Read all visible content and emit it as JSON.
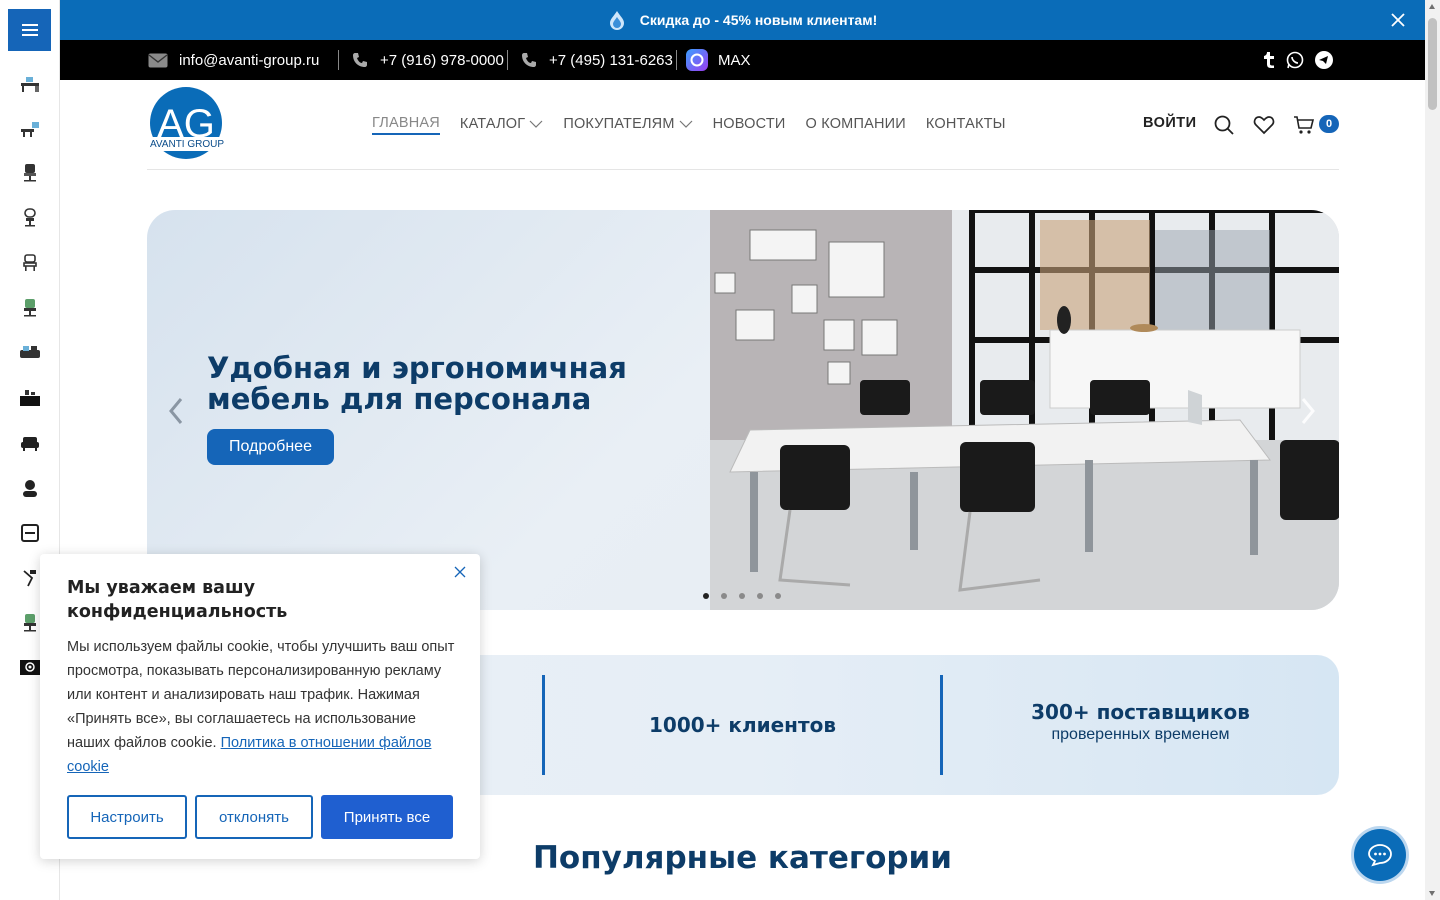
{
  "promo": {
    "text": "Скидка до - 45% новым клиентам!"
  },
  "contacts": {
    "email": "info@avanti-group.ru",
    "phone1": "+7 (916) 978-0000",
    "phone2": "+7 (495) 131-6263",
    "messenger": "MAX"
  },
  "header": {
    "logo_text": "AVANTI GROUP",
    "logo_mark": "AG",
    "nav": [
      {
        "label": "ГЛАВНАЯ"
      },
      {
        "label": "КАТАЛОГ"
      },
      {
        "label": "ПОКУПАТЕЛЯМ"
      },
      {
        "label": "НОВОСТИ"
      },
      {
        "label": "О КОМПАНИИ"
      },
      {
        "label": "КОНТАКТЫ"
      }
    ],
    "login_label": "ВОЙТИ",
    "cart_count": "0"
  },
  "hero": {
    "title_line1": "Удобная и эргономичная",
    "title_line2": "мебель для персонала",
    "button_label": "Подробнее",
    "slides_total": 5,
    "active_slide": 1
  },
  "stats": [
    {
      "big": "1000+ клиентов",
      "small": ""
    },
    {
      "big": "300+ поставщиков",
      "small": "проверенных временем"
    }
  ],
  "section_title": "Популярные категории",
  "cookie": {
    "title": "Мы уважаем вашу конфиденциальность",
    "text": "Мы используем файлы cookie, чтобы улучшить ваш опыт просмотра, показывать персонализированную рекламу или контент и анализировать наш трафик. Нажимая «Принять все», вы соглашаетесь на использование наших файлов cookie.",
    "link": "Политика в отношении файлов cookie",
    "btn_customize": "Настроить",
    "btn_reject": "отклонять",
    "btn_accept": "Принять все"
  },
  "colors": {
    "brand_blue": "#1565b8",
    "promo_blue": "#0a6cb8",
    "heading_navy": "#0d3c68"
  }
}
